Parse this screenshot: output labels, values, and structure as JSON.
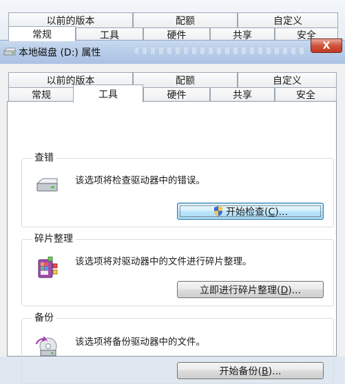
{
  "background_window": {
    "tabs_row1": [
      "以前的版本",
      "配额",
      "自定义"
    ],
    "tabs_row2": [
      "常规",
      "工具",
      "硬件",
      "共享",
      "安全"
    ],
    "active_tab": "常规"
  },
  "titlebar": {
    "title": "本地磁盘 (D:) 属性",
    "drive_icon": "drive-icon",
    "close_label": "X"
  },
  "dialog": {
    "tabs_row1": [
      "以前的版本",
      "配额",
      "自定义"
    ],
    "tabs_row2": [
      "常规",
      "工具",
      "硬件",
      "共享",
      "安全"
    ],
    "active_tab": "工具",
    "groups": {
      "error_check": {
        "title": "查错",
        "description": "该选项将检查驱动器中的错误。",
        "icon": "disk-check-icon",
        "button_text": "开始检查(",
        "button_key": "C",
        "button_tail": ")...",
        "button_icon": "uac-shield-icon"
      },
      "defrag": {
        "title": "碎片整理",
        "description": "该选项将对驱动器中的文件进行碎片整理。",
        "icon": "defrag-icon",
        "button_text": "立即进行碎片整理(",
        "button_key": "D",
        "button_tail": ")..."
      },
      "backup": {
        "title": "备份",
        "description": "该选项将备份驱动器中的文件。",
        "icon": "backup-icon",
        "button_text": "开始备份(",
        "button_key": "B",
        "button_tail": ")..."
      }
    }
  },
  "colors": {
    "titlebar": "#b8cde8",
    "close_button": "#c23a22",
    "dialog_bg": "#f0f0f0",
    "panel_bg": "#ffffff",
    "focus_button": "#bee6fd"
  }
}
